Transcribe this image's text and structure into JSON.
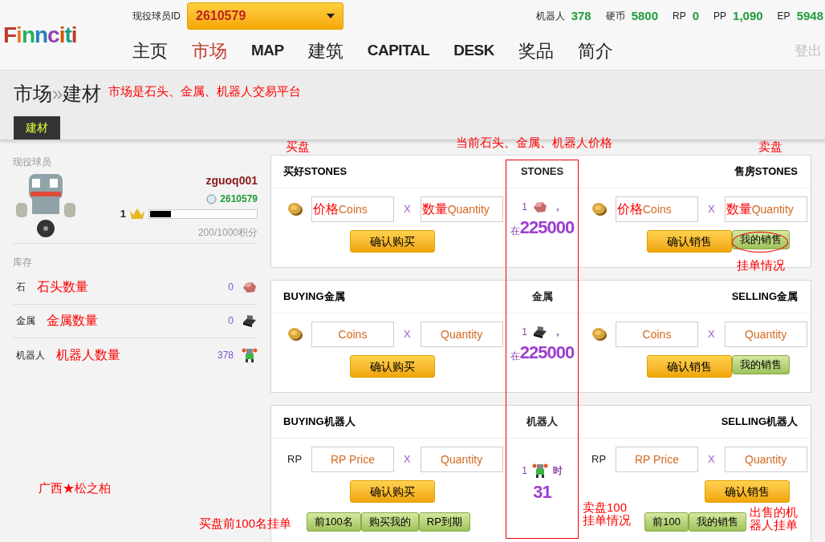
{
  "header": {
    "logo": "Finnciti",
    "player_id_label": "现役球员ID",
    "player_id": "2610579",
    "stats": [
      {
        "label": "机器人",
        "value": "378"
      },
      {
        "label": "硬币",
        "value": "5800"
      },
      {
        "label": "RP",
        "value": "0"
      },
      {
        "label": "PP",
        "value": "1,090"
      },
      {
        "label": "EP",
        "value": "5948"
      }
    ],
    "nav": [
      {
        "label": "主页",
        "selected": false
      },
      {
        "label": "市场",
        "selected": true
      },
      {
        "label": "MAP",
        "selected": false
      },
      {
        "label": "建筑",
        "selected": false
      },
      {
        "label": "CAPITAL",
        "selected": false
      },
      {
        "label": "DESK",
        "selected": false
      },
      {
        "label": "奖品",
        "selected": false
      },
      {
        "label": "简介",
        "selected": false
      }
    ],
    "logout": "登出"
  },
  "breadcrumb": {
    "section": "市场",
    "separator": "»",
    "page": "建材"
  },
  "tabs": [
    {
      "label": "建材",
      "selected": true
    }
  ],
  "sidebar": {
    "section_label": "现役球员",
    "username": "zguoq001",
    "user_id": "2610579",
    "rank": "1",
    "level": 0.2,
    "points": "200/1000积分",
    "inventory_label": "库存",
    "inventory": [
      {
        "name": "石",
        "note": "石头数量",
        "count": "0",
        "kind": "stone"
      },
      {
        "name": "金属",
        "note": "金属数量",
        "count": "0",
        "kind": "metal"
      },
      {
        "name": "机器人",
        "note": "机器人数量",
        "count": "378",
        "kind": "robot"
      }
    ]
  },
  "markets": [
    {
      "kind": "stone",
      "center_title": "STONES",
      "rate": {
        "qty": "1",
        "after": "，",
        "prefix": "在",
        "value": "225000"
      },
      "buy": {
        "title": "买好STONES",
        "kind": "coin",
        "price_note": "价格",
        "price_placeholder": "Coins",
        "times": "X",
        "quantity_note": "数量",
        "quantity_placeholder": "Quantity",
        "button": "确认购买"
      },
      "sell": {
        "title": "售房STONES",
        "kind": "coin",
        "price_note": "价格",
        "price_placeholder": "Coins",
        "times": "X",
        "quantity_note": "数量",
        "quantity_placeholder": "Quantity",
        "button": "确认销售",
        "extra": [
          "我的销售"
        ]
      }
    },
    {
      "kind": "metal",
      "center_title": "金属",
      "rate": {
        "qty": "1",
        "after": "，",
        "prefix": "在",
        "value": "225000"
      },
      "buy": {
        "title": "BUYING金属",
        "kind": "coin",
        "price_placeholder": "Coins",
        "times": "X",
        "quantity_placeholder": "Quantity",
        "button": "确认购买"
      },
      "sell": {
        "title": "SELLING金属",
        "kind": "coin",
        "price_placeholder": "Coins",
        "times": "X",
        "quantity_placeholder": "Quantity",
        "button": "确认销售",
        "extra": [
          "我的销售"
        ]
      }
    },
    {
      "kind": "robot",
      "center_title": "机器人",
      "rate": {
        "qty": "1",
        "after": "时",
        "value": "31"
      },
      "buy": {
        "title": "BUYING机器人",
        "kind": "label",
        "pay_label": "RP",
        "price_placeholder": "RP Price",
        "times": "X",
        "quantity_placeholder": "Quantity",
        "button": "确认购买",
        "extra": [
          "前100名",
          "购买我的",
          "RP到期"
        ]
      },
      "sell": {
        "title": "SELLING机器人",
        "kind": "label",
        "pay_label": "RP",
        "price_placeholder": "RP Price",
        "times": "X",
        "quantity_placeholder": "Quantity",
        "button": "确认销售",
        "extra": [
          "前100",
          "我的销售"
        ]
      }
    }
  ],
  "annotations": [
    {
      "lines": [
        "市场是石头、金属、机器人交易平台"
      ]
    },
    {
      "lines": [
        "买盘"
      ]
    },
    {
      "lines": [
        "当前石头、金属、机器人价格"
      ]
    },
    {
      "lines": [
        "卖盘"
      ]
    },
    {
      "lines": [
        "挂单情况"
      ]
    },
    {
      "lines": [
        "广西★松之柏"
      ]
    },
    {
      "lines": [
        "买盘前100名挂单"
      ]
    },
    {
      "lines": [
        "卖盘100",
        "挂单情况"
      ]
    },
    {
      "lines": [
        "出售的机",
        "器人挂单"
      ]
    }
  ]
}
